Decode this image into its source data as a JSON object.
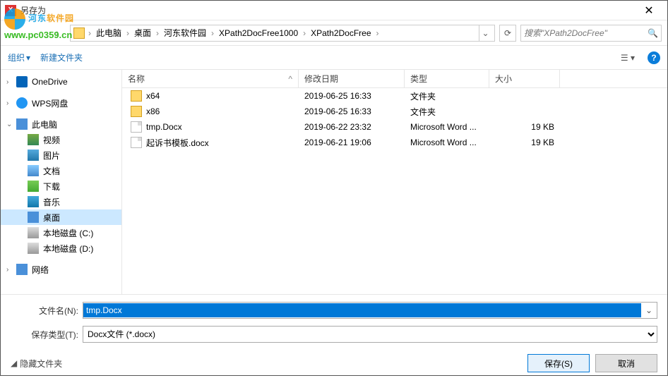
{
  "watermark": {
    "title_a": "河东",
    "title_b": "软件园",
    "url": "www.pc0359.cn"
  },
  "window": {
    "title": "另存为"
  },
  "breadcrumb": {
    "root": "此电脑",
    "items": [
      "桌面",
      "河东软件园",
      "XPath2DocFree1000",
      "XPath2DocFree"
    ]
  },
  "search": {
    "placeholder": "搜索\"XPath2DocFree\""
  },
  "toolbar": {
    "organize": "组织",
    "newfolder": "新建文件夹"
  },
  "sidebar": {
    "onedrive": "OneDrive",
    "wps": "WPS网盘",
    "pc": "此电脑",
    "video": "视频",
    "pic": "图片",
    "doc": "文档",
    "dl": "下载",
    "music": "音乐",
    "desktop": "桌面",
    "diskC": "本地磁盘 (C:)",
    "diskD": "本地磁盘 (D:)",
    "net": "网络"
  },
  "columns": {
    "name": "名称",
    "date": "修改日期",
    "type": "类型",
    "size": "大小"
  },
  "files": [
    {
      "name": "x64",
      "date": "2019-06-25 16:33",
      "type": "文件夹",
      "size": "",
      "icon": "folder"
    },
    {
      "name": "x86",
      "date": "2019-06-25 16:33",
      "type": "文件夹",
      "size": "",
      "icon": "folder"
    },
    {
      "name": "tmp.Docx",
      "date": "2019-06-22 23:32",
      "type": "Microsoft Word ...",
      "size": "19 KB",
      "icon": "docx"
    },
    {
      "name": "起诉书模板.docx",
      "date": "2019-06-21 19:06",
      "type": "Microsoft Word ...",
      "size": "19 KB",
      "icon": "docx"
    }
  ],
  "form": {
    "filename_label": "文件名(N):",
    "filename_value": "tmp.Docx",
    "filetype_label": "保存类型(T):",
    "filetype_value": "Docx文件 (*.docx)"
  },
  "footer": {
    "hide": "隐藏文件夹",
    "save": "保存(S)",
    "cancel": "取消"
  }
}
